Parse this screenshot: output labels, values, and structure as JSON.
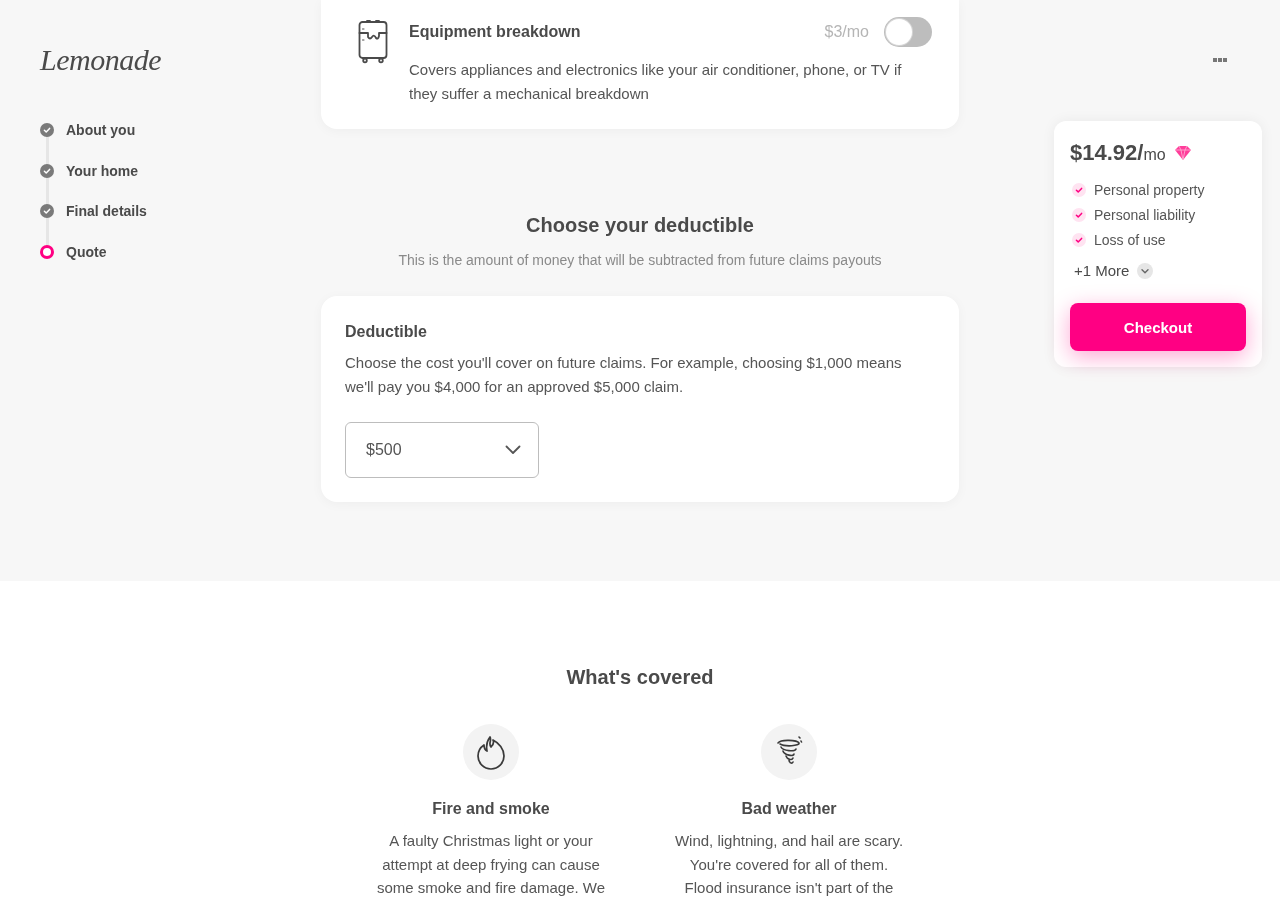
{
  "sidebar": {
    "logo": "Lemonade",
    "steps": [
      {
        "label": "About you",
        "completed": true,
        "selected": false
      },
      {
        "label": "Your home",
        "completed": true,
        "selected": false
      },
      {
        "label": "Final details",
        "completed": true,
        "selected": false
      },
      {
        "label": "Quote",
        "completed": false,
        "selected": true
      }
    ]
  },
  "coverage_addon": {
    "title": "Equipment breakdown",
    "price": "$3/mo",
    "on": false,
    "description": "Covers appliances and electronics like your air conditioner, phone, or TV if they suffer a mechanical breakdown"
  },
  "deductible_section": {
    "heading": "Choose your deductible",
    "subtitle": "This is the amount of money that will be subtracted from future claims payouts",
    "card": {
      "title": "Deductible",
      "description": "Choose the cost you'll cover on future claims. For example, choosing $1,000 means we'll pay you $4,000 for an approved $5,000 claim.",
      "select": {
        "value": "$500"
      }
    }
  },
  "whats_covered": {
    "heading": "What's covered",
    "items": [
      {
        "kind": "fire",
        "title": "Fire and smoke",
        "description": "A faulty Christmas light or your attempt at deep frying can cause some smoke and fire damage. We"
      },
      {
        "kind": "storm",
        "title": "Bad weather",
        "description": "Wind, lightning, and hail are scary. You're covered for all of them. Flood insurance isn't part of the"
      }
    ]
  },
  "price_summary": {
    "price": "$14.92/",
    "period": "mo",
    "features": [
      "Personal property",
      "Personal liability",
      "Loss of use"
    ],
    "more": "+1 More",
    "checkout": "Checkout"
  }
}
